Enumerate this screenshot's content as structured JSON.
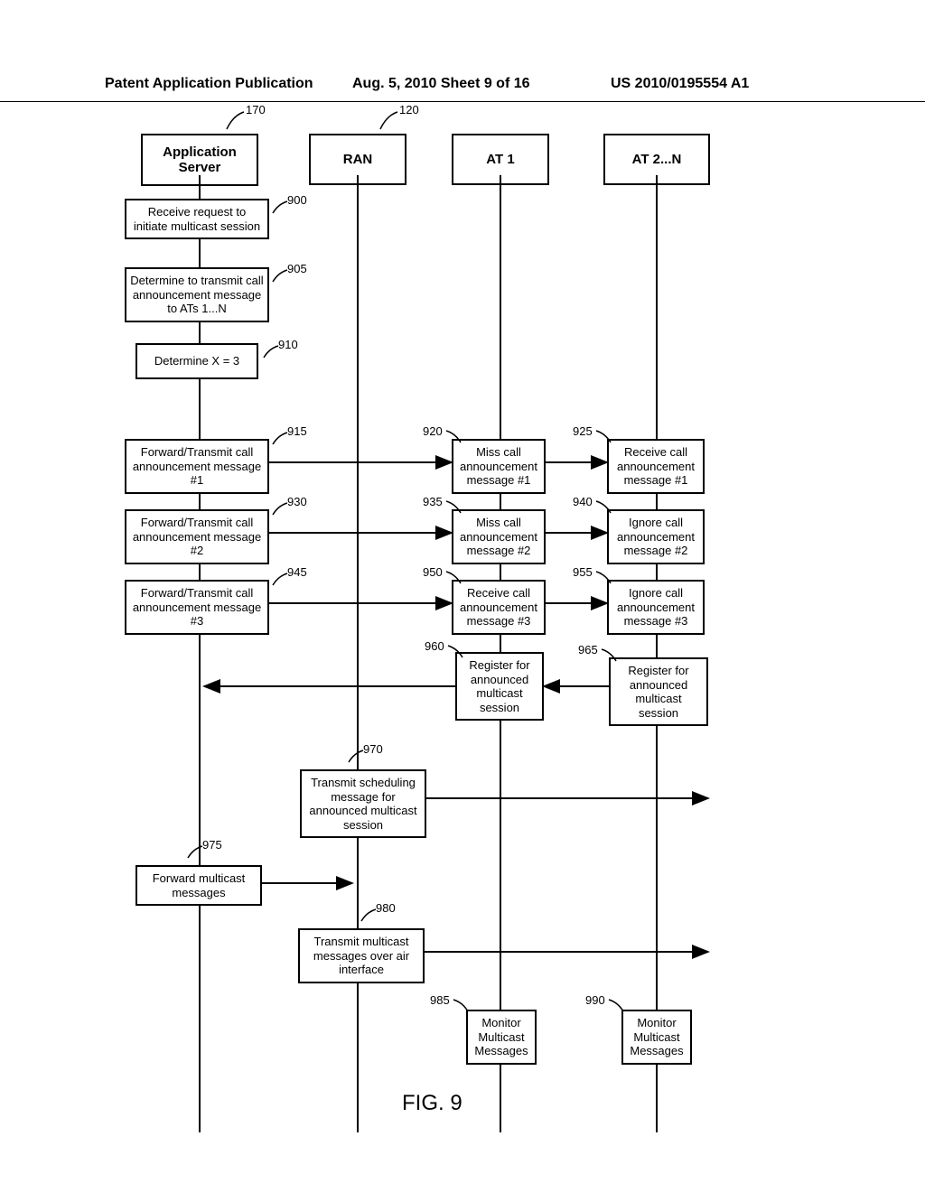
{
  "header": {
    "left": "Patent Application Publication",
    "center": "Aug. 5, 2010  Sheet 9 of 16",
    "right": "US 2010/0195554 A1"
  },
  "lanes": {
    "app_server": "Application Server",
    "ran": "RAN",
    "at1": "AT 1",
    "at2n": "AT 2...N"
  },
  "refs": {
    "r170": "170",
    "r120": "120",
    "r900": "900",
    "r905": "905",
    "r910": "910",
    "r915": "915",
    "r920": "920",
    "r925": "925",
    "r930": "930",
    "r935": "935",
    "r940": "940",
    "r945": "945",
    "r950": "950",
    "r955": "955",
    "r960": "960",
    "r965": "965",
    "r970": "970",
    "r975": "975",
    "r980": "980",
    "r985": "985",
    "r990": "990"
  },
  "boxes": {
    "b900": "Receive request to initiate multicast session",
    "b905": "Determine to transmit call announcement message to ATs 1...N",
    "b910": "Determine X = 3",
    "b915": "Forward/Transmit call announcement message #1",
    "b920": "Miss call announcement message #1",
    "b925": "Receive call announcement message #1",
    "b930": "Forward/Transmit call announcement message #2",
    "b935": "Miss call announcement message #2",
    "b940": "Ignore call announcement message #2",
    "b945": "Forward/Transmit call announcement message #3",
    "b950": "Receive call announcement message #3",
    "b955": "Ignore call announcement message #3",
    "b960": "Register for announced multicast session",
    "b965": "Register for announced multicast session",
    "b970": "Transmit scheduling message for announced multicast session",
    "b975": "Forward multicast messages",
    "b980": "Transmit multicast messages over air interface",
    "b985": "Monitor Multicast Messages",
    "b990": "Monitor Multicast Messages"
  },
  "figure_caption": "FIG. 9"
}
